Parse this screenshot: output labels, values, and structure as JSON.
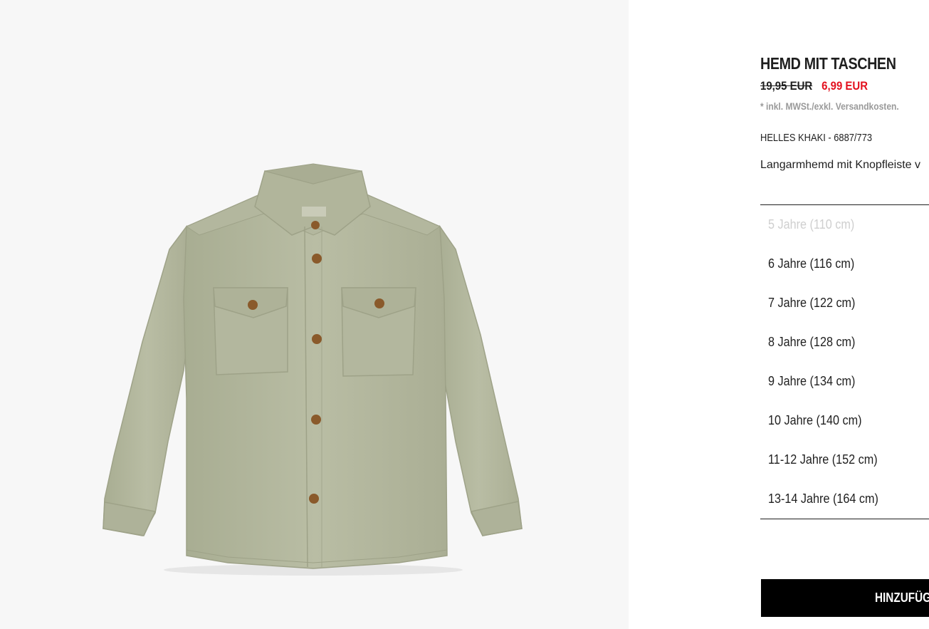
{
  "product": {
    "image_alt": "Hemd mit Taschen in Helles Khaki",
    "title": "HEMD MIT TASCHEN",
    "old_price": "19,95 EUR",
    "new_price": "6,99 EUR",
    "tax_note": "* inkl. MWSt./exkl. Versandkosten.",
    "color_reference": "HELLES KHAKI - 6887/773",
    "description": "Langarmhemd mit Knopfleiste v",
    "sizes": [
      {
        "label": "5 Jahre (110 cm)",
        "available": false
      },
      {
        "label": "6 Jahre (116 cm)",
        "available": true
      },
      {
        "label": "7 Jahre (122 cm)",
        "available": true
      },
      {
        "label": "8 Jahre (128 cm)",
        "available": true
      },
      {
        "label": "9 Jahre (134 cm)",
        "available": true
      },
      {
        "label": "10 Jahre (140 cm)",
        "available": true
      },
      {
        "label": "11-12 Jahre (152 cm)",
        "available": true
      },
      {
        "label": "13-14 Jahre (164 cm)",
        "available": true
      }
    ],
    "add_button_label": "HINZUFÜG"
  },
  "colors": {
    "sale_price": "#e3101e",
    "tax_note": "#9a9a9a",
    "unavailable_size": "#cfcfcf",
    "button_bg": "#000000",
    "shirt": "#b5b9a0"
  }
}
